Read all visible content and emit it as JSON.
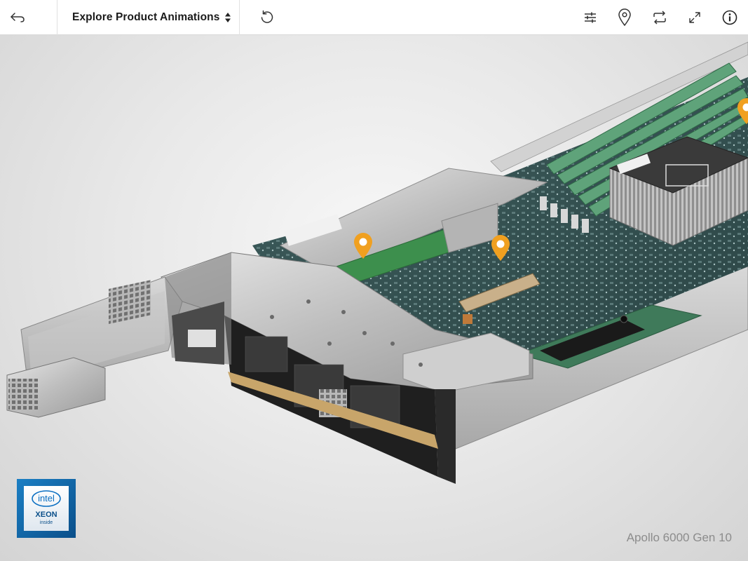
{
  "toolbar": {
    "back_icon": "back-arrow-icon",
    "title": "Explore Product Animations",
    "title_dropdown_icon": "sort-arrows-icon",
    "reset_icon": "reset-rotate-icon",
    "right_icons": [
      "filter-sliders-icon",
      "location-pin-icon",
      "rotate-view-icon",
      "fullscreen-icon",
      "info-icon"
    ]
  },
  "viewer": {
    "model_name": "Apollo 6000 Gen 10",
    "hotspot_color": "#f0a020",
    "hotspots": [
      "hotspot-1",
      "hotspot-2",
      "hotspot-3"
    ],
    "badge": {
      "brand": "intel",
      "line": "XEON",
      "sub": "inside"
    }
  }
}
